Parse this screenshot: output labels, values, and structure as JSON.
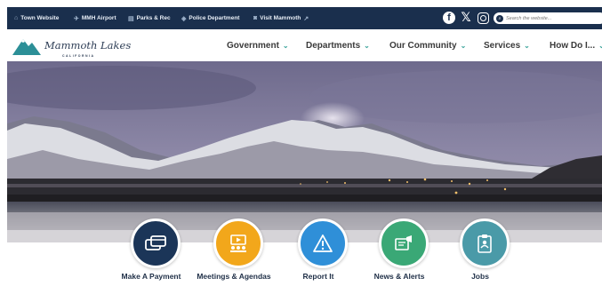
{
  "utility_links": [
    {
      "label": "Town Website",
      "icon": "home-icon"
    },
    {
      "label": "MMH Airport",
      "icon": "plane-icon"
    },
    {
      "label": "Parks & Rec",
      "icon": "park-icon"
    },
    {
      "label": "Police Department",
      "icon": "badge-icon"
    },
    {
      "label": "Visit Mammoth",
      "icon": "camera-icon"
    }
  ],
  "social": [
    "facebook-icon",
    "x-icon",
    "instagram-icon"
  ],
  "search": {
    "placeholder": "Search the website..."
  },
  "logo": {
    "text": "Mammoth Lakes",
    "sub": "CALIFORNIA"
  },
  "nav": [
    {
      "label": "Government"
    },
    {
      "label": "Departments"
    },
    {
      "label": "Our Community"
    },
    {
      "label": "Services"
    },
    {
      "label": "How Do I..."
    }
  ],
  "quick_links": [
    {
      "label": "Make A Payment",
      "color": "#1b3558",
      "icon": "payment-icon"
    },
    {
      "label": "Meetings & Agendas",
      "color": "#f2a71b",
      "icon": "meeting-icon"
    },
    {
      "label": "Report It",
      "color": "#2f8fd8",
      "icon": "warning-icon"
    },
    {
      "label": "News & Alerts",
      "color": "#3aa876",
      "icon": "news-icon"
    },
    {
      "label": "Jobs",
      "color": "#4a9aa8",
      "icon": "jobs-icon"
    }
  ],
  "colors": {
    "topbar": "#1a2f4d",
    "accent": "#3aa39b"
  }
}
